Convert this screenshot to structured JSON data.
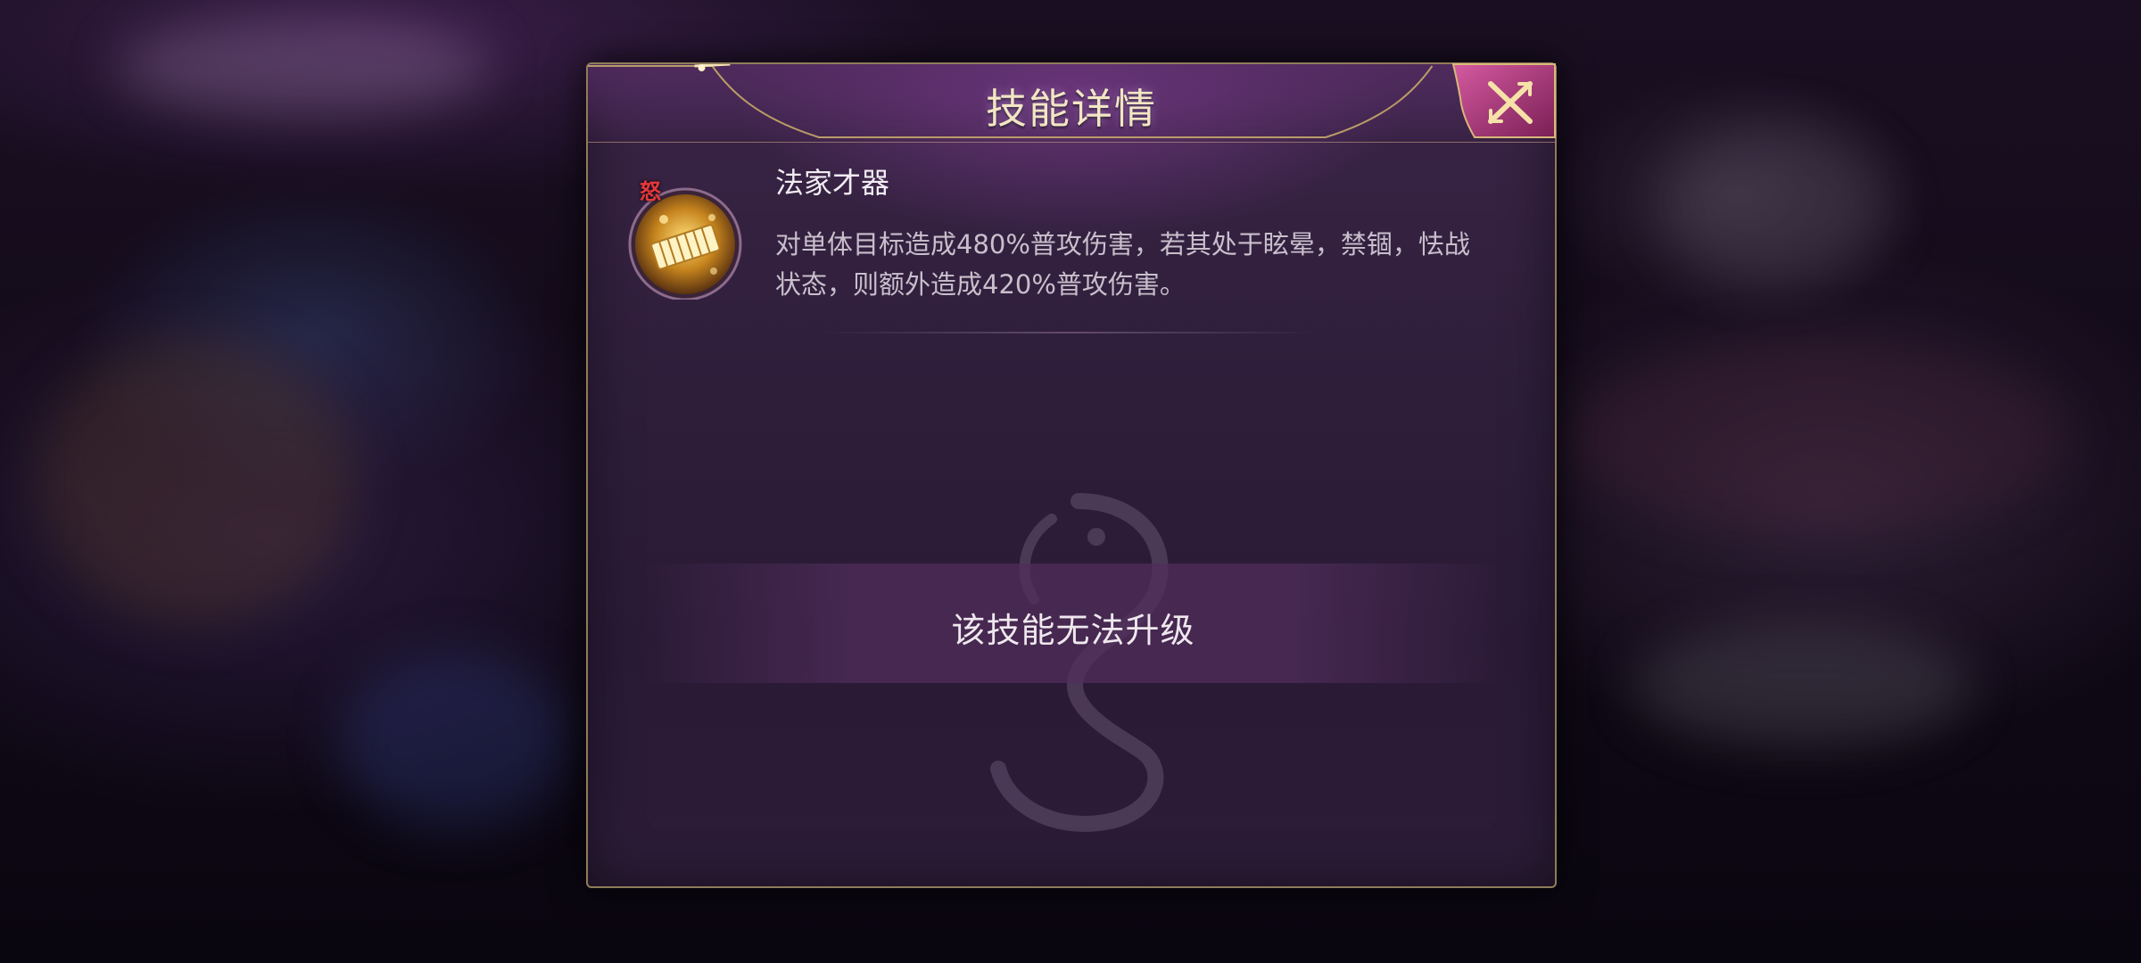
{
  "dialog": {
    "title": "技能详情",
    "close_icon": "close-x-icon"
  },
  "skill": {
    "badge": "怒",
    "icon": "golden-bamboo-scroll-icon",
    "name": "法家才器",
    "description": "对单体目标造成480%普攻伤害，若其处于眩晕，禁锢，怯战状态，则额外造成420%普攻伤害。"
  },
  "status": {
    "message": "该技能无法升级"
  },
  "colors": {
    "gold_border": "#8f7c5a",
    "close_button": "#c04a8a",
    "title_text": "#f2e6c4",
    "panel_bg": "#2e1e3a"
  }
}
